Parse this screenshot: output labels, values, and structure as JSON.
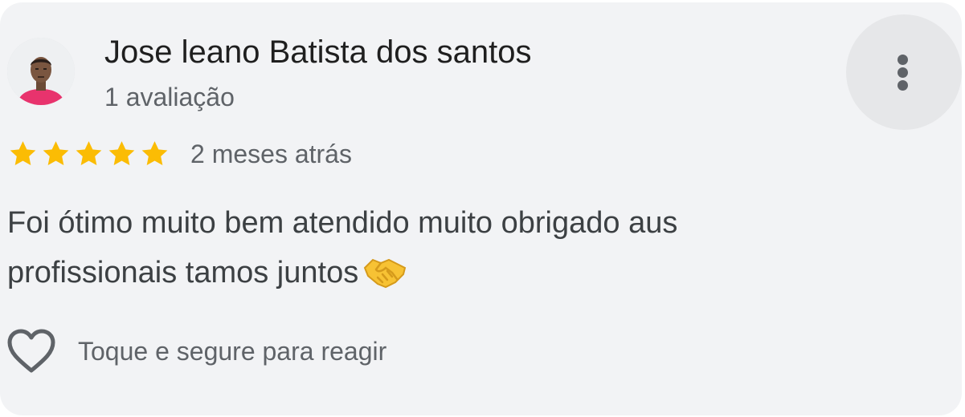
{
  "review": {
    "author_name": "Jose leano Batista dos santos",
    "review_count": "1 avaliação",
    "rating": 5,
    "rating_max": 5,
    "time_ago": "2 meses atrás",
    "text_line1": "Foi ótimo muito bem atendido muito obrigado aus",
    "text_line2": "profissionais tamos juntos",
    "emoji": "handshake-emoji",
    "react_label": "Toque e segure para reagir"
  },
  "icons": {
    "menu": "more-vertical-icon",
    "react": "heart-outline-icon",
    "star": "star-icon"
  },
  "colors": {
    "card_background": "#f2f3f5",
    "star": "#fbbc04",
    "primary_text": "#1f1f1f",
    "secondary_text": "#5f6368",
    "body_text": "#3c4043",
    "avatar_shirt": "#e8336d"
  }
}
